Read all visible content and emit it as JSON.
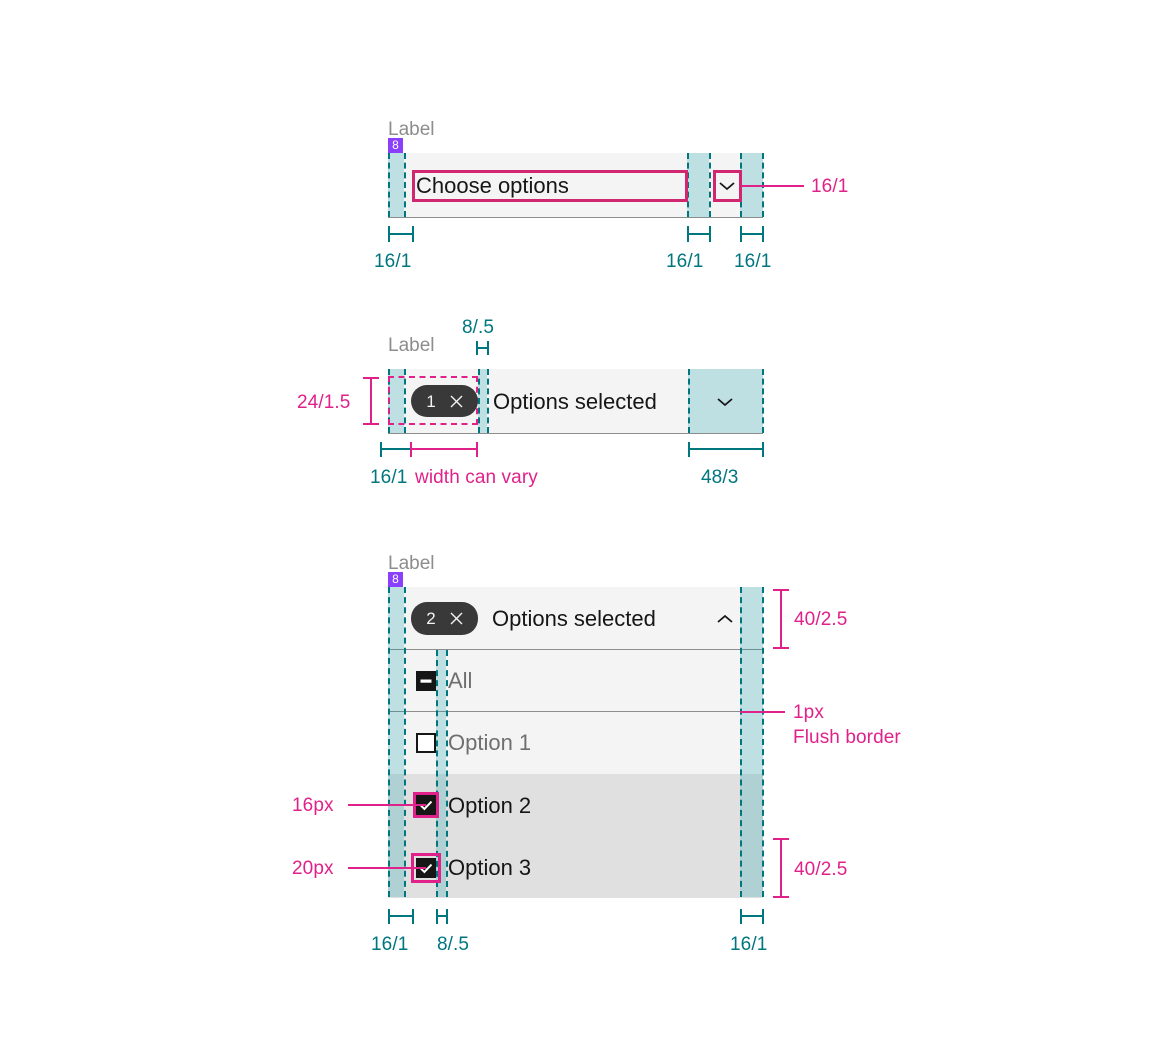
{
  "meta": {
    "accent_teal": "#00767f",
    "accent_pink": "#e0218a",
    "badge_purple": "#8a3ffc",
    "field_bg": "#f4f4f4",
    "row_hover_bg": "#e0e0e0",
    "pill_bg": "#393939"
  },
  "section1": {
    "label": "Label",
    "badge": "8",
    "placeholder": "Choose options",
    "chevron_icon": "chevron-down-icon",
    "callout_right": "16/1",
    "measure_left": "16/1",
    "measure_mid": "16/1",
    "measure_right": "16/1"
  },
  "section2": {
    "label": "Label",
    "top_measure": "8/.5",
    "left_measure": "24/1.5",
    "tag_count": "1",
    "tag_close_icon": "close-icon",
    "value_text": "Options selected",
    "chevron_icon": "chevron-down-icon",
    "measure_left": "16/1",
    "measure_vary": "width can vary",
    "measure_right": "48/3"
  },
  "section3": {
    "label": "Label",
    "badge": "8",
    "tag_count": "2",
    "tag_close_icon": "close-icon",
    "value_text": "Options selected",
    "chevron_icon": "chevron-up-icon",
    "measure_header_height": "40/2.5",
    "measure_row_height": "40/2.5",
    "border_note_1": "1px",
    "border_note_2": "Flush border",
    "checkbox_note_1": "16px",
    "checkbox_note_2": "20px",
    "measure_left": "16/1",
    "measure_gap": "8/.5",
    "measure_right": "16/1",
    "options": [
      {
        "label": "All",
        "state": "indeterminate",
        "icon": "checkbox-indeterminate-icon"
      },
      {
        "label": "Option 1",
        "state": "unchecked",
        "icon": "checkbox-unchecked-icon"
      },
      {
        "label": "Option 2",
        "state": "checked",
        "icon": "checkbox-checked-icon"
      },
      {
        "label": "Option 3",
        "state": "checked",
        "icon": "checkbox-checked-icon"
      }
    ]
  }
}
